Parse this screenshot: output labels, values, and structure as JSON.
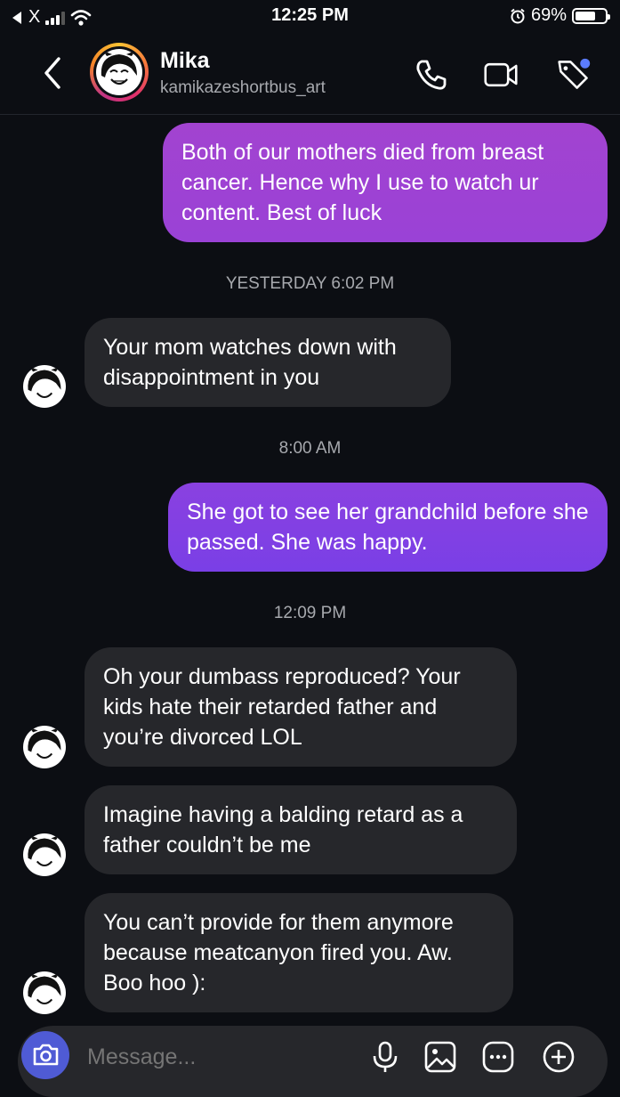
{
  "status_bar": {
    "carrier_back": "X",
    "time": "12:25 PM",
    "battery_percent": "69%",
    "battery_level": 0.69
  },
  "header": {
    "name": "Mika",
    "handle": "kamikazeshortbus_art"
  },
  "messages": [
    {
      "direction": "out",
      "text": "Both of our mothers died from breast cancer. Hence why  I use to watch ur content. Best of luck"
    },
    {
      "type": "timestamp",
      "text": "YESTERDAY 6:02 PM"
    },
    {
      "direction": "in",
      "text": "Your mom watches down with disappointment in you"
    },
    {
      "type": "timestamp",
      "text": "8:00 AM"
    },
    {
      "direction": "out",
      "text": "She got to see her grandchild before she passed. She was happy."
    },
    {
      "type": "timestamp",
      "text": "12:09 PM"
    },
    {
      "direction": "in",
      "text": "Oh your dumbass reproduced? Your kids hate their retarded father and you’re divorced LOL"
    },
    {
      "direction": "in",
      "text": "Imagine having a balding retard as a father couldn’t be me"
    },
    {
      "direction": "in",
      "text": "You can’t provide for them anymore because meatcanyon fired you. Aw. Boo hoo ):"
    }
  ],
  "composer": {
    "placeholder": "Message..."
  },
  "colors": {
    "background": "#0c0e13",
    "incoming_bubble": "#26272b",
    "outgoing_top": "#a243d0",
    "outgoing_bottom": "#7a3fe6",
    "camera_button": "#4f5bd5",
    "notification_dot": "#5b7cff"
  },
  "icons": [
    "back-arrow-icon",
    "phone-icon",
    "video-call-icon",
    "tag-icon",
    "camera-icon",
    "microphone-icon",
    "gallery-icon",
    "sticker-icon",
    "add-icon"
  ]
}
